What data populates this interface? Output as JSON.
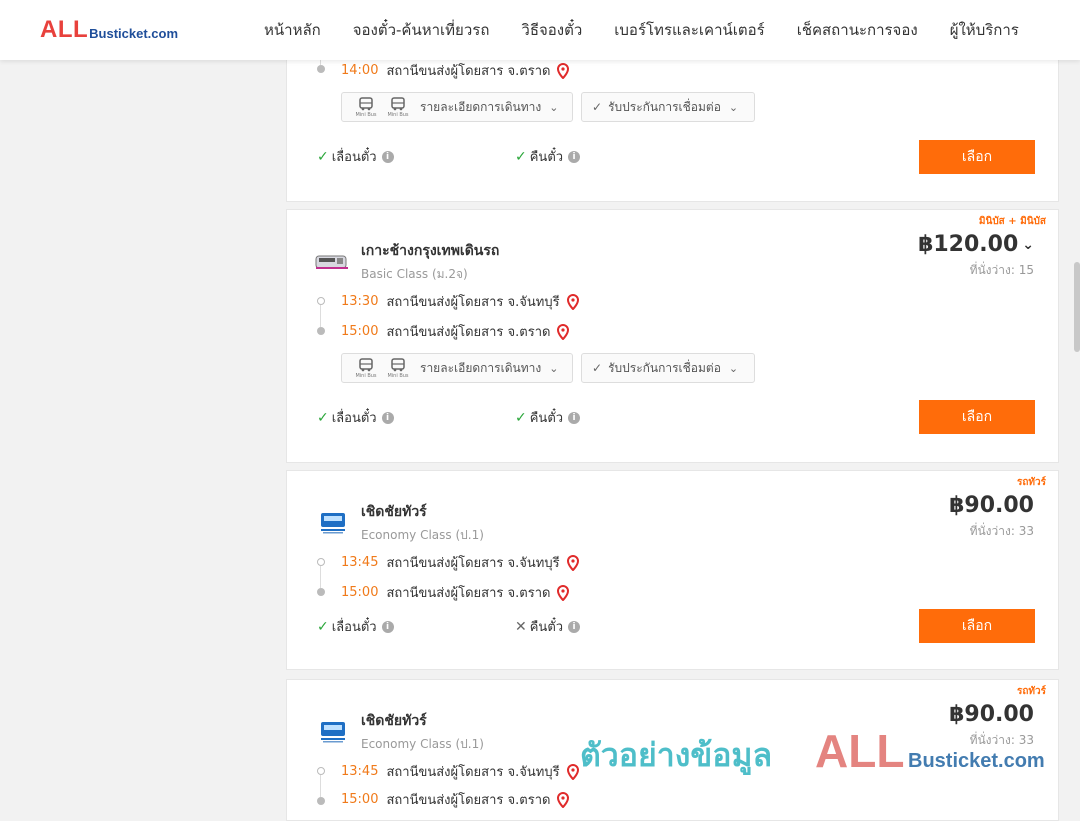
{
  "header": {
    "logo_all": "ALL",
    "logo_domain": "Busticket.com",
    "nav": [
      "หน้าหลัก",
      "จองตั๋ว-ค้นหาเที่ยวรถ",
      "วิธีจองตั๋ว",
      "เบอร์โทรและเคาน์เตอร์",
      "เช็คสถานะการจอง",
      "ผู้ให้บริการ"
    ]
  },
  "labels": {
    "route_details": "รายละเอียดการเดินทาง",
    "connection_insurance": "รับประกันการเชื่อมต่อ",
    "reschedule": "เลื่อนตั๋ว",
    "refund": "คืนตั๋ว",
    "select": "เลือก",
    "bus_icon_label": "Mini Bus"
  },
  "cards": [
    {
      "arrive_time": "14:00",
      "arrive_place": "สถานีขนส่งผู้โดยสาร จ.ตราด",
      "reschedule_ok": true,
      "refund_ok": true
    },
    {
      "type_tag": "มินิบัส + มินิบัส",
      "operator": "เกาะช้างกรุงเทพเดินรถ",
      "class": "Basic Class (ม.2จ)",
      "price": "฿120.00",
      "seats": "ที่นั่งว่าง: 15",
      "depart_time": "13:30",
      "depart_place": "สถานีขนส่งผู้โดยสาร จ.จันทบุรี",
      "arrive_time": "15:00",
      "arrive_place": "สถานีขนส่งผู้โดยสาร จ.ตราด",
      "reschedule_ok": true,
      "refund_ok": true
    },
    {
      "type_tag": "รถทัวร์",
      "operator": "เชิดชัยทัวร์",
      "class": "Economy Class (ป.1)",
      "price": "฿90.00",
      "seats": "ที่นั่งว่าง: 33",
      "depart_time": "13:45",
      "depart_place": "สถานีขนส่งผู้โดยสาร จ.จันทบุรี",
      "arrive_time": "15:00",
      "arrive_place": "สถานีขนส่งผู้โดยสาร จ.ตราด",
      "reschedule_ok": true,
      "refund_ok": false
    },
    {
      "type_tag": "รถทัวร์",
      "operator": "เชิดชัยทัวร์",
      "class": "Economy Class (ป.1)",
      "price": "฿90.00",
      "seats": "ที่นั่งว่าง: 33",
      "depart_time": "13:45",
      "depart_place": "สถานีขนส่งผู้โดยสาร จ.จันทบุรี",
      "arrive_time": "15:00",
      "arrive_place": "สถานีขนส่งผู้โดยสาร จ.ตราด"
    }
  ],
  "watermark": {
    "thai": "ตัวอย่างข้อมูล",
    "all": "ALL",
    "domain": "Busticket.com"
  },
  "colors": {
    "accent": "#ff6c0a",
    "time": "#f07a1a",
    "check": "#2aa63a",
    "pin": "#e02b2b",
    "logo_red": "#e8413c",
    "logo_blue": "#1f4e9a"
  }
}
